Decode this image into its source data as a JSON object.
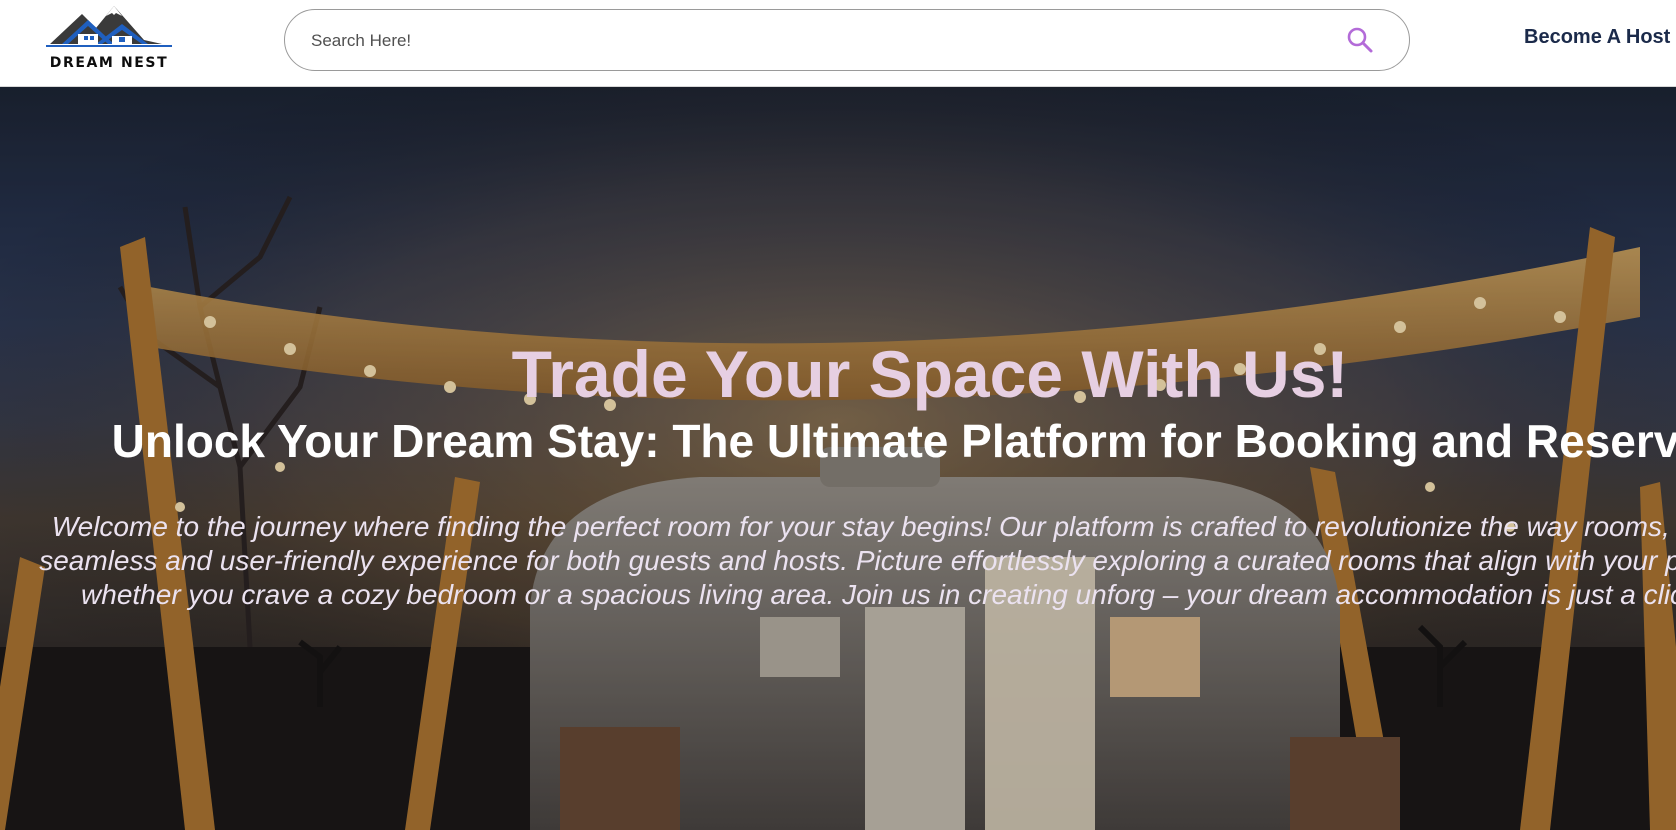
{
  "header": {
    "logo": {
      "name": "DREAM NEST",
      "icon": "house-mountain-logo-icon",
      "colors": {
        "roof": "#1f5fbf",
        "mountain": "#3a3a3a"
      }
    },
    "search": {
      "placeholder": "Search Here!",
      "icon": "search-icon",
      "icon_color": "#b36bd8"
    },
    "host_link": "Become A Host"
  },
  "hero": {
    "title": "Trade Your Space With Us!",
    "subtitle": "Unlock Your Dream Stay: The Ultimate Platform for Booking and Reserving",
    "description": "Welcome to the journey where finding the perfect room for your stay begins! Our platform is crafted to revolutionize the way rooms, ensuring a seamless and user-friendly experience for both guests and hosts. Picture effortlessly exploring a curated rooms that align with your preferences, whether you crave a cozy bedroom or a spacious living area. Join us in creating unforg – your dream accommodation is just a click away!",
    "title_color": "#e6cfe2"
  }
}
